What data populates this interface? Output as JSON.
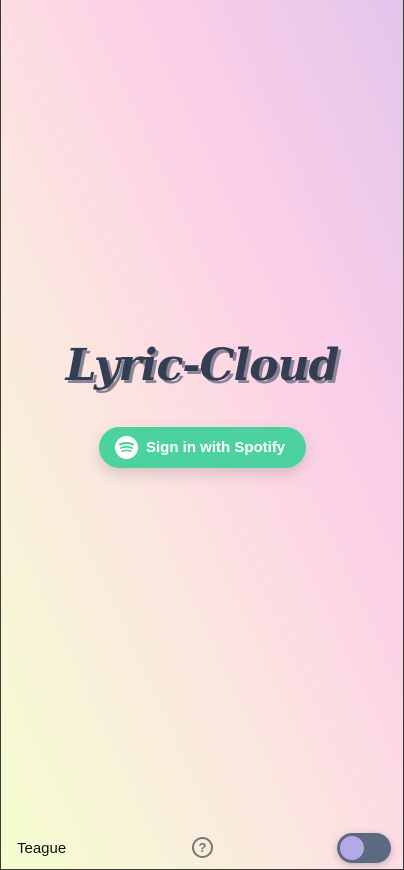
{
  "app": {
    "title": "Lyric-Cloud"
  },
  "signin": {
    "label": "Sign in with Spotify",
    "icon": "spotify-icon"
  },
  "footer": {
    "name": "Teague",
    "help_icon": "?",
    "theme_toggle_on": false
  },
  "colors": {
    "accent": "#4bd29f",
    "title": "#343e52",
    "toggle": "#5c6a80",
    "knob": "#b3a9e6"
  }
}
